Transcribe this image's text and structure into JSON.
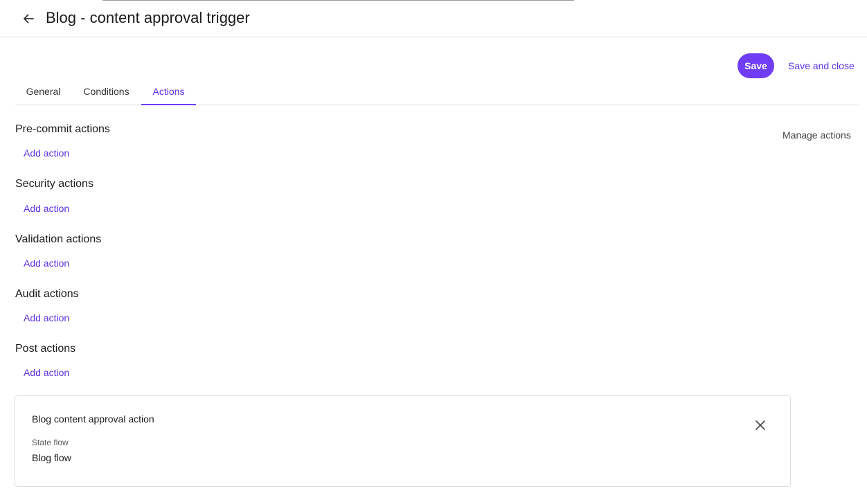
{
  "header": {
    "title": "Blog - content approval trigger",
    "back_icon": "arrow-left-icon"
  },
  "toolbar": {
    "save_label": "Save",
    "save_close_label": "Save and close",
    "accent_color": "#6e3df5"
  },
  "tabs": [
    {
      "label": "General",
      "active": false
    },
    {
      "label": "Conditions",
      "active": false
    },
    {
      "label": "Actions",
      "active": true
    }
  ],
  "manage_actions_label": "Manage actions",
  "sections": [
    {
      "title": "Pre-commit actions",
      "add_label": "Add action"
    },
    {
      "title": "Security actions",
      "add_label": "Add action"
    },
    {
      "title": "Validation actions",
      "add_label": "Add action"
    },
    {
      "title": "Audit actions",
      "add_label": "Add action"
    },
    {
      "title": "Post actions",
      "add_label": "Add action"
    }
  ],
  "action_card": {
    "title": "Blog content approval action",
    "field_label": "State flow",
    "field_value": "Blog flow",
    "close_icon": "close-icon"
  }
}
